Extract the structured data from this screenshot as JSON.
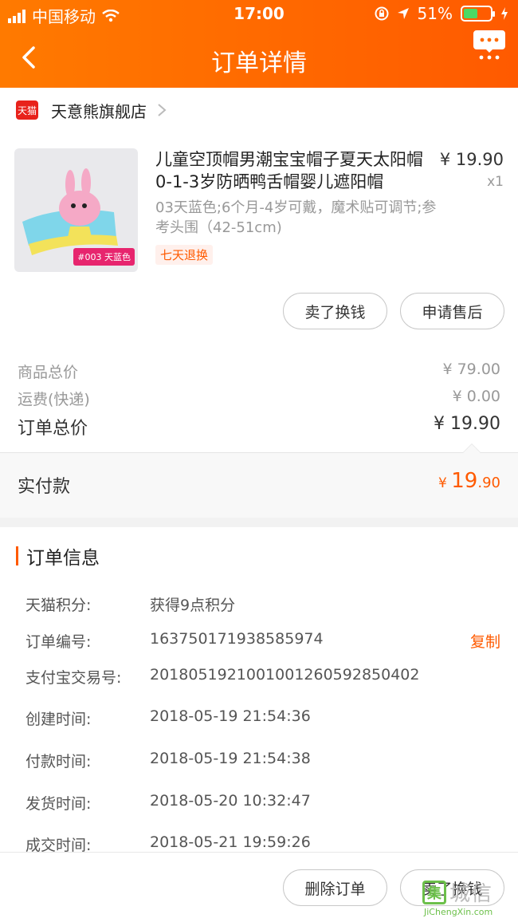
{
  "status_bar": {
    "carrier": "中国移动",
    "time": "17:00",
    "battery_percent": "51%",
    "battery_level": 0.51
  },
  "nav": {
    "title": "订单详情",
    "back_icon": "chevron-left-icon",
    "more_icon": "more-icon"
  },
  "store": {
    "logo_text": "天猫",
    "name": "天意熊旗舰店"
  },
  "product": {
    "title": "儿童空顶帽男潮宝宝帽子夏天太阳帽0-1-3岁防晒鸭舌帽婴儿遮阳帽",
    "price": "¥ 19.90",
    "quantity": "x1",
    "spec": "03天蓝色;6个月-4岁可戴，魔术贴可调节;参考头围（42-51cm)",
    "return_badge": "七天退换",
    "image_tag": "#003 天蓝色"
  },
  "item_actions": {
    "sell_label": "卖了换钱",
    "after_sale_label": "申请售后"
  },
  "summary": {
    "goods_total_label": "商品总价",
    "goods_total_value": "¥ 79.00",
    "shipping_label": "运费(快递)",
    "shipping_value": "¥ 0.00",
    "order_total_label": "订单总价",
    "order_total_value": "¥ 19.90"
  },
  "paid": {
    "label": "实付款",
    "currency": "¥ ",
    "integer": "19",
    "decimal": ".90"
  },
  "order_info": {
    "heading": "订单信息",
    "copy_label": "复制",
    "rows": [
      {
        "label": "天猫积分:",
        "value": "获得9点积分"
      },
      {
        "label": "订单编号:",
        "value": "163750171938585974"
      },
      {
        "label": "支付宝交易号:",
        "value": "2018051921001001260592850402"
      },
      {
        "label": "创建时间:",
        "value": "2018-05-19 21:54:36"
      },
      {
        "label": "付款时间:",
        "value": "2018-05-19 21:54:38"
      },
      {
        "label": "发货时间:",
        "value": "2018-05-20 10:32:47"
      },
      {
        "label": "成交时间:",
        "value": "2018-05-21 19:59:26"
      }
    ]
  },
  "bottom_actions": {
    "delete_label": "删除订单",
    "sell_label": "卖了换钱"
  },
  "watermark": {
    "mark": "集",
    "cn": "城信",
    "en": "JiChengXin.com"
  },
  "colors": {
    "accent": "#ff5a00",
    "header_start": "#ff7a00",
    "battery_green": "#4cd964"
  }
}
